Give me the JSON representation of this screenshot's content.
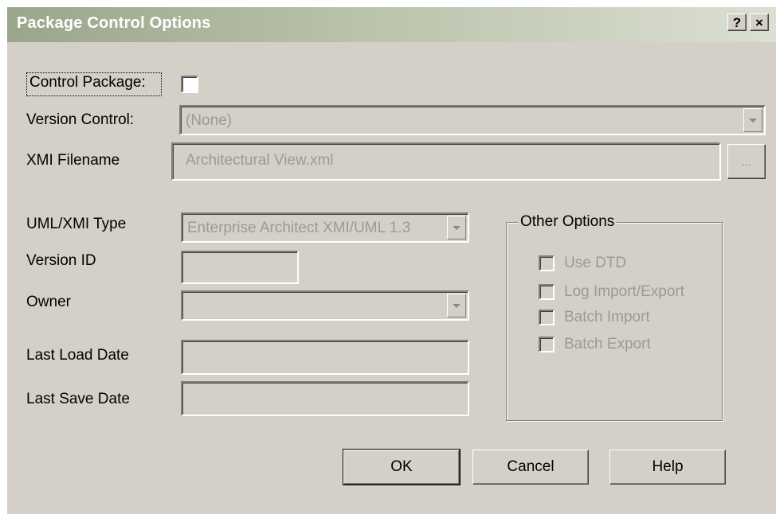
{
  "window": {
    "title": "Package Control Options",
    "help_glyph": "?",
    "close_glyph": "×"
  },
  "form": {
    "control_package": {
      "label": "Control Package:",
      "checked": false
    },
    "version_control": {
      "label": "Version Control:",
      "value": "(None)"
    },
    "xmi_filename": {
      "label": "XMI Filename",
      "value": "Architectural View.xml",
      "browse_label": "..."
    },
    "uml_xmi_type": {
      "label": "UML/XMI Type",
      "value": "Enterprise Architect XMI/UML 1.3"
    },
    "version_id": {
      "label": "Version ID",
      "value": ""
    },
    "owner": {
      "label": "Owner",
      "value": ""
    },
    "last_load_date": {
      "label": "Last Load Date",
      "value": ""
    },
    "last_save_date": {
      "label": "Last Save Date",
      "value": ""
    }
  },
  "other_options": {
    "title": "Other Options",
    "items": [
      {
        "label": "Use DTD",
        "checked": false
      },
      {
        "label": "Log Import/Export",
        "checked": false
      },
      {
        "label": "Batch Import",
        "checked": false
      },
      {
        "label": "Batch Export",
        "checked": false
      }
    ]
  },
  "buttons": {
    "ok": "OK",
    "cancel": "Cancel",
    "help": "Help"
  }
}
